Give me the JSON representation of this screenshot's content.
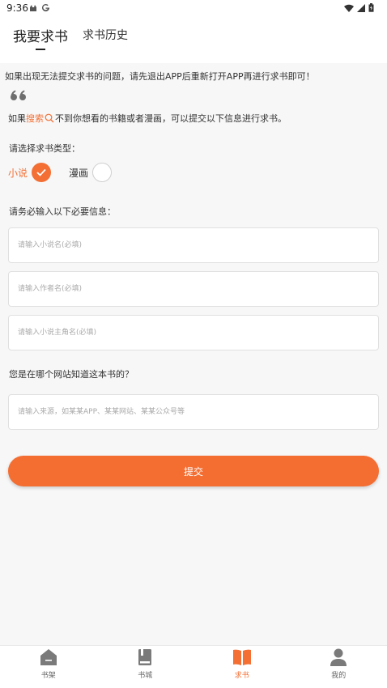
{
  "status_bar": {
    "time": "9:36"
  },
  "header": {
    "tab_active": "我要求书",
    "tab_history": "求书历史"
  },
  "notice": "如果出现无法提交求书的问题，请先退出APP后重新打开APP再进行求书即可！",
  "hint": {
    "prefix": "如果",
    "search_word": "搜索",
    "suffix": "不到你想看的书籍或者漫画，可以提交以下信息进行求书。"
  },
  "type_select": {
    "label": "请选择求书类型：",
    "options": [
      {
        "label": "小说",
        "selected": true
      },
      {
        "label": "漫画",
        "selected": false
      }
    ]
  },
  "required_label": "请务必输入以下必要信息：",
  "fields": {
    "novel_name_placeholder": "请输入小说名(必填)",
    "author_placeholder": "请输入作者名(必填)",
    "protagonist_placeholder": "请输入小说主角名(必填)"
  },
  "source_label": "您是在哪个网站知道这本书的？",
  "source_placeholder": "请输入来源，如某某APP、某某网站、某某公众号等",
  "submit_label": "提交",
  "bottom_nav": [
    {
      "label": "书架",
      "icon": "house-icon",
      "active": false
    },
    {
      "label": "书城",
      "icon": "book-icon",
      "active": false
    },
    {
      "label": "求书",
      "icon": "open-book-icon",
      "active": true
    },
    {
      "label": "我的",
      "icon": "person-icon",
      "active": false
    }
  ],
  "colors": {
    "accent": "#f36f34",
    "inactive": "#666666",
    "background": "#f7f7f7"
  }
}
